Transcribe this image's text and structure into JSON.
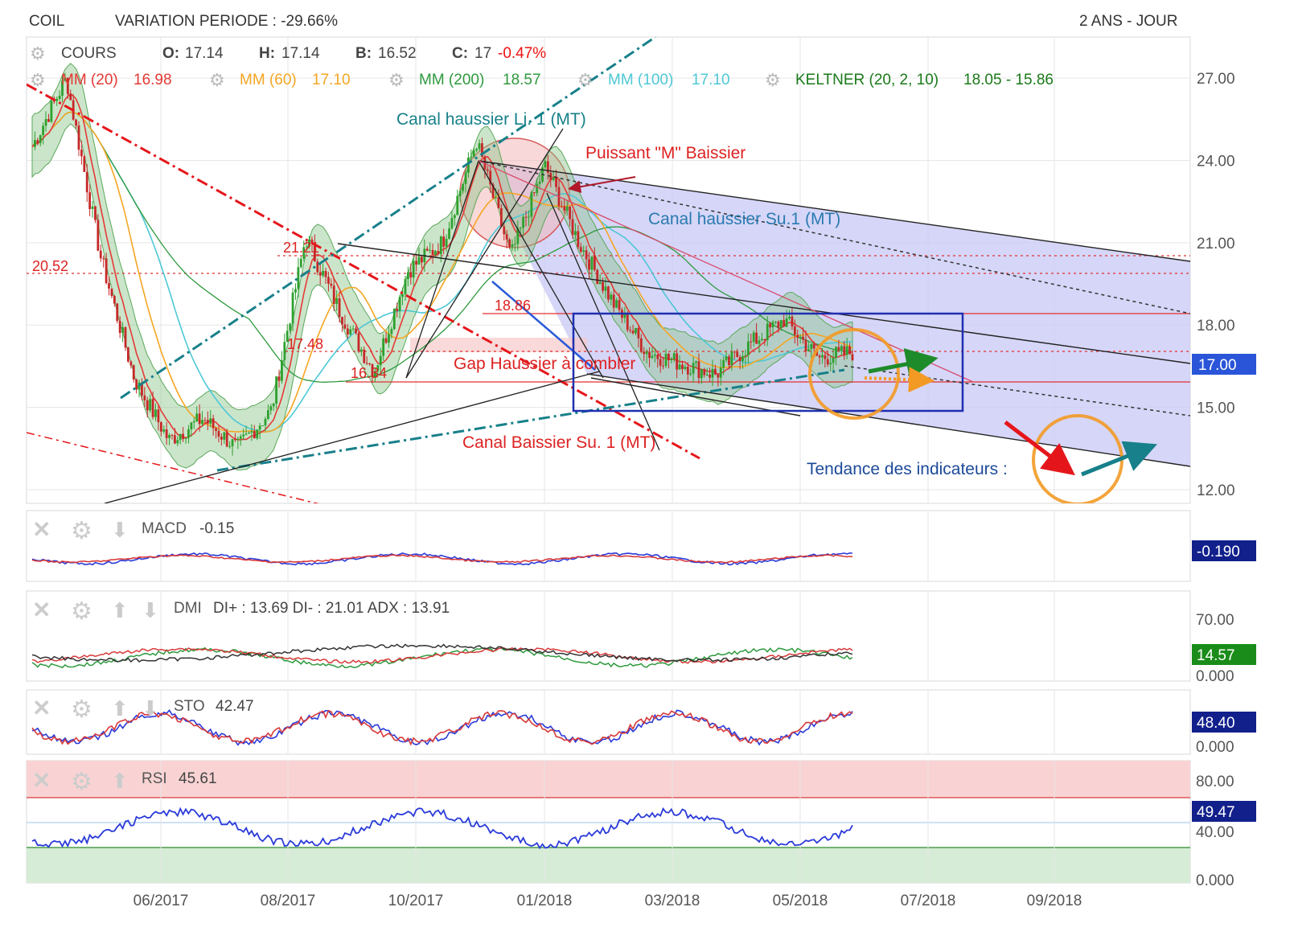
{
  "header": {
    "symbol": "COIL",
    "variation": "VARIATION PERIODE : -29.66%",
    "period": "2 ANS - JOUR"
  },
  "legend": {
    "cours": {
      "label": "COURS",
      "o_key": "O:",
      "o_val": "17.14",
      "h_key": "H:",
      "h_val": "17.14",
      "b_key": "B:",
      "b_val": "16.52",
      "c_key": "C:",
      "c_val": "17",
      "c_chg": "-0.47%"
    },
    "mm20": {
      "label": "MM (20)",
      "val": "16.98"
    },
    "mm60": {
      "label": "MM (60)",
      "val": "17.10"
    },
    "mm200": {
      "label": "MM (200)",
      "val": "18.57"
    },
    "mm100": {
      "label": "MM (100)",
      "val": "17.10"
    },
    "keltner": {
      "label": "KELTNER (20, 2, 10)",
      "val": "18.05 - 15.86"
    }
  },
  "annotations": {
    "canal_haussier_li": "Canal haussier Li. 1 (MT)",
    "puissant_m": "Puissant \"M\" Baissier",
    "canal_haussier_su": "Canal haussier Su.1 (MT)",
    "gap": "Gap Haussier à combler",
    "canal_baissier": "Canal Baissier Su. 1 (MT)",
    "tendance": "Tendance des indicateurs :",
    "lvl_2121": "21.21",
    "lvl_2052": "20.52",
    "lvl_1886": "18.86",
    "lvl_1748": "17.48",
    "lvl_1634": "16.34"
  },
  "panels": {
    "macd": {
      "label": "MACD",
      "value": "-0.15",
      "badge": "-0.190"
    },
    "dmi": {
      "label": "DMI",
      "value": "DI+ : 13.69 DI- : 21.01 ADX : 13.91",
      "badge": "14.57"
    },
    "sto": {
      "label": "STO",
      "value": "42.47",
      "badge": "48.40"
    },
    "rsi": {
      "label": "RSI",
      "value": "45.61",
      "badge": "49.47"
    }
  },
  "colors": {
    "price_up": "#2ea02e",
    "price_down": "#c62828",
    "mm20": "#e53935",
    "mm60": "#f5a623",
    "mm200": "#2e9a3e",
    "mm100": "#4dc8d6",
    "keltner_fill": "#8cc68c",
    "channel_fill": "#c8c8f5",
    "box": "#1f2fb0",
    "badge_price": "#2a55d8",
    "badge_dark": "#12208c",
    "badge_green": "#1a8c1a"
  },
  "chart_data": {
    "type": "candlestick",
    "title": "COIL",
    "x_ticks": [
      "06/2017",
      "08/2017",
      "10/2017",
      "01/2018",
      "03/2018",
      "05/2018",
      "07/2018",
      "09/2018"
    ],
    "y_ticks": [
      "27.00",
      "24.00",
      "21.00",
      "18.00",
      "15.00",
      "12.00"
    ],
    "ylim": [
      11.5,
      28.5
    ],
    "last_price_badge": "17.00",
    "grid": true,
    "price_series": [
      {
        "date": "2017-04",
        "close": 24.5
      },
      {
        "date": "2017-04-20",
        "close": 27.0
      },
      {
        "date": "2017-05-01",
        "close": 20.5
      },
      {
        "date": "2017-05-15",
        "close": 16.0
      },
      {
        "date": "2017-06-01",
        "close": 13.8
      },
      {
        "date": "2017-07-01",
        "close": 14.6
      },
      {
        "date": "2017-08-01",
        "close": 13.5
      },
      {
        "date": "2017-08-20",
        "close": 14.9
      },
      {
        "date": "2017-09-05",
        "close": 21.2
      },
      {
        "date": "2017-09-20",
        "close": 18.5
      },
      {
        "date": "2017-10-05",
        "close": 16.3
      },
      {
        "date": "2017-10-20",
        "close": 20.0
      },
      {
        "date": "2017-11-05",
        "close": 21.0
      },
      {
        "date": "2017-11-20",
        "close": 24.7
      },
      {
        "date": "2017-12-05",
        "close": 20.5
      },
      {
        "date": "2017-12-20",
        "close": 23.8
      },
      {
        "date": "2018-01-10",
        "close": 21.0
      },
      {
        "date": "2018-01-25",
        "close": 18.8
      },
      {
        "date": "2018-02-10",
        "close": 17.0
      },
      {
        "date": "2018-03-01",
        "close": 16.6
      },
      {
        "date": "2018-03-20",
        "close": 16.2
      },
      {
        "date": "2018-04-05",
        "close": 17.3
      },
      {
        "date": "2018-04-25",
        "close": 18.2
      },
      {
        "date": "2018-05-10",
        "close": 16.8
      },
      {
        "date": "2018-06-01",
        "close": 17.0
      }
    ],
    "horizontal_levels": [
      21.21,
      20.52,
      18.86,
      17.48,
      16.34
    ],
    "indicator_y_ticks": {
      "dmi": [
        "70.00",
        "0.000"
      ],
      "sto": [
        "0.000"
      ],
      "rsi": [
        "80.00",
        "40.00",
        "0.000"
      ]
    }
  }
}
